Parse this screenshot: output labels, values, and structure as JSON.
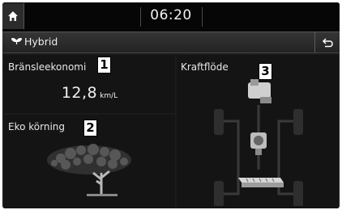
{
  "status": {
    "time": "06:20"
  },
  "titlebar": {
    "title": "Hybrid"
  },
  "panels": {
    "fuel": {
      "label": "Bränsleekonomi",
      "value": "12,8",
      "unit": "km/L",
      "callout": "1"
    },
    "eco": {
      "label": "Eko körning",
      "callout": "2"
    },
    "power": {
      "label": "Kraftflöde",
      "callout": "3"
    }
  },
  "icons": {
    "home": "home-icon",
    "leaf": "leaf-icon",
    "back": "back-arrow-icon",
    "engine": "engine-icon",
    "motor": "motor-icon",
    "battery": "battery-icon"
  },
  "colors": {
    "background": "#1b1b1b",
    "statusbar": "#060606",
    "text": "#eeeeee"
  }
}
